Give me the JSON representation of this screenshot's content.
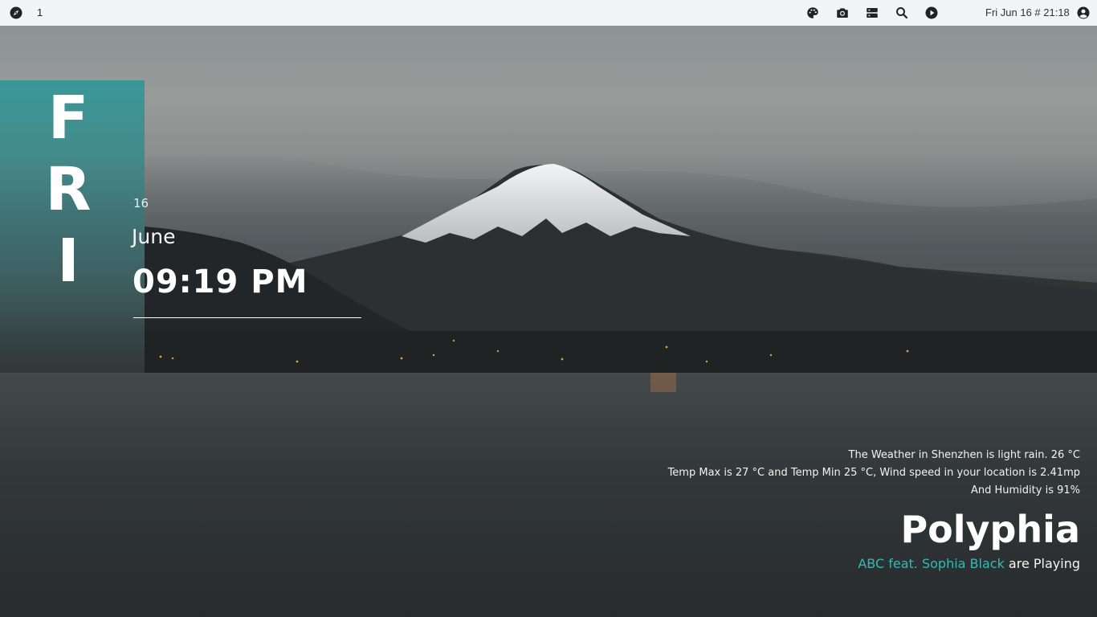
{
  "topbar": {
    "launcher_icon": "compass-icon",
    "workspace": "1",
    "tray_icons": [
      "palette-icon",
      "camera-icon",
      "storage-icon",
      "search-icon",
      "play-icon"
    ],
    "clock": "Fri Jun 16 # 21:18",
    "user_icon": "account-icon"
  },
  "date_widget": {
    "day_letters": [
      "F",
      "R",
      "I"
    ],
    "day_number": "16",
    "month": "June",
    "time": "09:19 PM",
    "accent": "#1f9696"
  },
  "weather": {
    "line1": "The Weather in Shenzhen is light rain. 26 °C",
    "line2": "Temp Max is 27 °C and Temp Min 25 °C, Wind speed in your location is 2.41mp",
    "line3": "And Humidity is 91%"
  },
  "now_playing": {
    "artist": "Polyphia",
    "song": "ABC feat. Sophia Black",
    "suffix": " are Playing",
    "accent": "#3bb6b6"
  }
}
